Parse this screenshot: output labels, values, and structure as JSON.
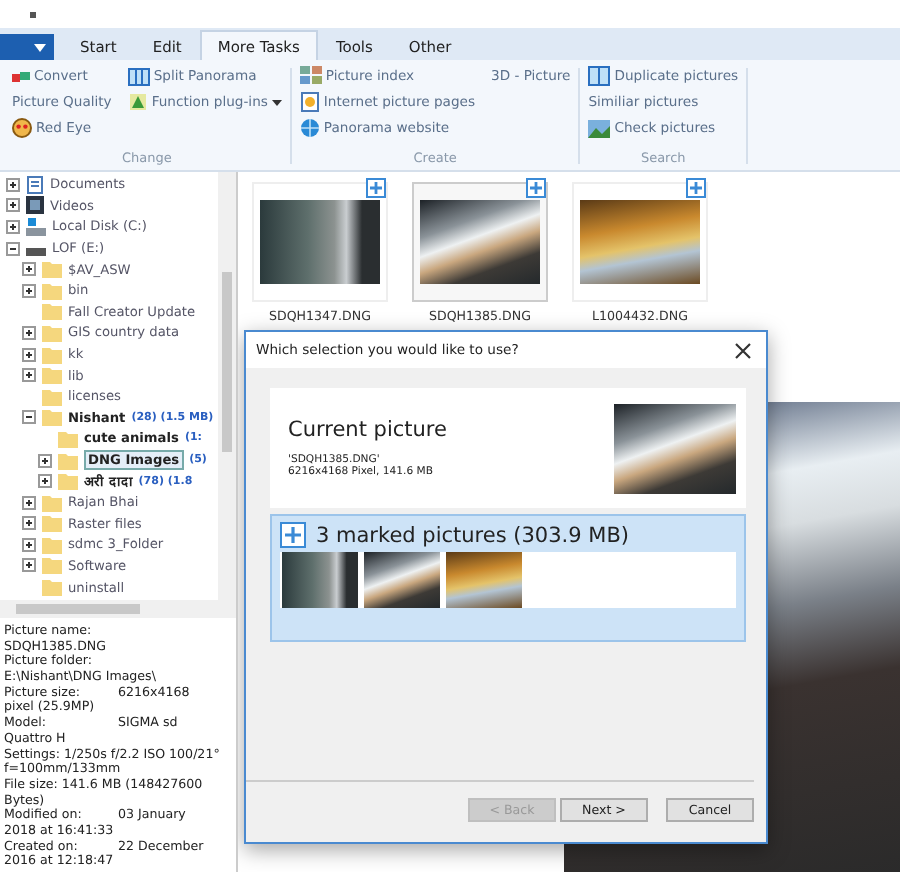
{
  "ribbon": {
    "tabs": [
      {
        "label": "Start",
        "selected": false
      },
      {
        "label": "Edit",
        "selected": false
      },
      {
        "label": "More Tasks",
        "selected": true
      },
      {
        "label": "Tools",
        "selected": false
      },
      {
        "label": "Other",
        "selected": false
      }
    ],
    "groups": [
      {
        "label": "Change",
        "columns": [
          [
            {
              "label": "Convert"
            },
            {
              "label": "Picture Quality"
            },
            {
              "label": "Red Eye"
            }
          ],
          [
            {
              "label": "Split Panorama"
            },
            {
              "label": "Function plug-ins",
              "dropdown": true
            }
          ]
        ]
      },
      {
        "label": "Create",
        "columns": [
          [
            {
              "label": "Picture index"
            },
            {
              "label": "Internet picture pages"
            },
            {
              "label": "Panorama website"
            }
          ],
          [
            {
              "label": "3D - Picture"
            }
          ]
        ]
      },
      {
        "label": "Search",
        "columns": [
          [
            {
              "label": "Duplicate pictures"
            },
            {
              "label": "Similiar pictures"
            },
            {
              "label": "Check pictures"
            }
          ]
        ]
      }
    ]
  },
  "tree": [
    {
      "label": "Documents",
      "kind": "branch",
      "expanded": false,
      "selected": false
    },
    {
      "label": "Videos",
      "kind": "branch",
      "expanded": false,
      "selected": false
    },
    {
      "label": "Local Disk (C:)",
      "kind": "branch",
      "expanded": false,
      "selected": false
    },
    {
      "label": "LOF (E:)",
      "kind": "branch",
      "expanded": true,
      "selected": false,
      "children": [
        {
          "label": "$AV_ASW",
          "kind": "branch",
          "expanded": false,
          "selected": false
        },
        {
          "label": "bin",
          "kind": "branch",
          "expanded": false,
          "selected": false
        },
        {
          "label": "Fall Creator Update",
          "kind": "leaf",
          "selected": false
        },
        {
          "label": "GIS country data",
          "kind": "branch",
          "expanded": false,
          "selected": false
        },
        {
          "label": "kk",
          "kind": "branch",
          "expanded": false,
          "selected": false
        },
        {
          "label": "lib",
          "kind": "branch",
          "expanded": false,
          "selected": false
        },
        {
          "label": "licenses",
          "kind": "leaf",
          "selected": false
        },
        {
          "label": "Nishant",
          "count": "(28) (1.5 MB)",
          "kind": "branch",
          "expanded": true,
          "selected": false,
          "children": [
            {
              "label": "cute animals",
              "count": "(1:",
              "kind": "leaf",
              "selected": false
            },
            {
              "label": "DNG Images",
              "count": "(5)",
              "kind": "branch",
              "expanded": false,
              "selected": true
            },
            {
              "label": "अरी दादा",
              "count": "(78) (1.8",
              "kind": "branch",
              "expanded": false,
              "selected": false
            }
          ]
        },
        {
          "label": "Rajan Bhai",
          "kind": "branch",
          "expanded": false,
          "selected": false
        },
        {
          "label": "Raster files",
          "kind": "branch",
          "expanded": false,
          "selected": false
        },
        {
          "label": "sdmc 3_Folder",
          "kind": "branch",
          "expanded": false,
          "selected": false
        },
        {
          "label": "Software",
          "kind": "branch",
          "expanded": false,
          "selected": false
        },
        {
          "label": "uninstall",
          "kind": "leaf",
          "selected": false
        }
      ]
    }
  ],
  "info": [
    {
      "text": "Picture name:"
    },
    {
      "text": "SDQH1385.DNG"
    },
    {
      "text": "Picture folder:"
    },
    {
      "text": "E:\\Nishant\\DNG Images\\"
    },
    {
      "text": "Picture size:",
      "value": "6216x4168"
    },
    {
      "text": "pixel (25.9MP)"
    },
    {
      "text": "Model:",
      "value": "SIGMA sd"
    },
    {
      "text": "Quattro H"
    },
    {
      "text": "Settings: 1/250s f/2.2 ISO 100/21°"
    },
    {
      "text": "f=100mm/133mm"
    },
    {
      "text": "File size:  141.6 MB (148427600"
    },
    {
      "text": "Bytes)"
    },
    {
      "text": "Modified on:",
      "value": "03 January"
    },
    {
      "text": "2018 at 16:41:33"
    },
    {
      "text": "Created on:",
      "value": "22 December"
    },
    {
      "text": "2016 at 12:18:47"
    }
  ],
  "thumbnails": [
    {
      "name": "SDQH1347.DNG",
      "selected": false
    },
    {
      "name": "SDQH1385.DNG",
      "selected": true
    },
    {
      "name": "L1004432.DNG",
      "selected": false
    }
  ],
  "dialog": {
    "title": "Which selection you would like to use?",
    "options": [
      {
        "kind": "current",
        "title": "Current picture",
        "file": "'SDQH1385.DNG'",
        "details": "6216x4168 Pixel, 141.6 MB",
        "selected": false
      },
      {
        "kind": "marked",
        "title": "3 marked pictures (303.9 MB)",
        "selected": true
      }
    ],
    "buttons": [
      {
        "label": "< Back",
        "disabled": true
      },
      {
        "label": "Next >",
        "disabled": false
      },
      {
        "label": "Cancel",
        "disabled": false
      }
    ]
  }
}
